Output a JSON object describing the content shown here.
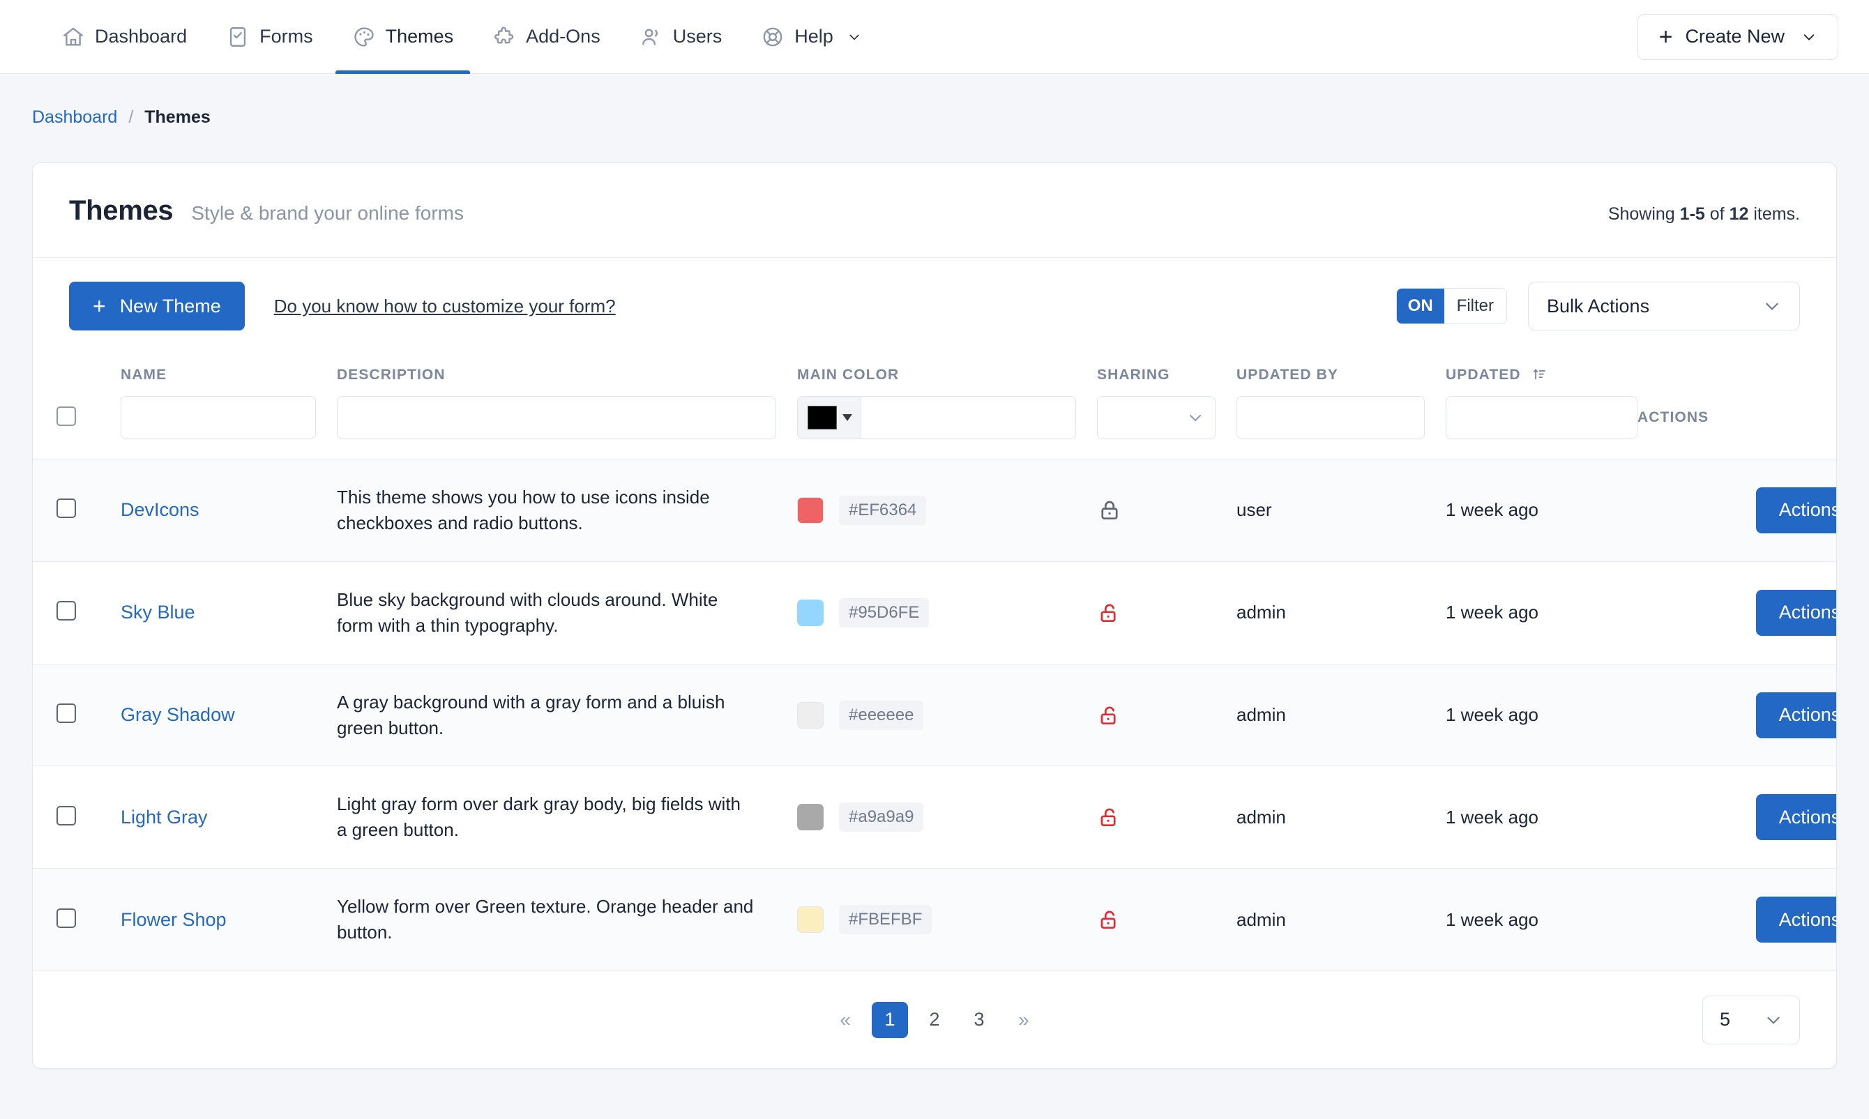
{
  "nav": {
    "items": [
      {
        "label": "Dashboard",
        "icon": "home-icon",
        "active": false
      },
      {
        "label": "Forms",
        "icon": "form-check-icon",
        "active": false
      },
      {
        "label": "Themes",
        "icon": "palette-icon",
        "active": true
      },
      {
        "label": "Add-Ons",
        "icon": "puzzle-icon",
        "active": false
      },
      {
        "label": "Users",
        "icon": "users-icon",
        "active": false
      },
      {
        "label": "Help",
        "icon": "lifebuoy-icon",
        "active": false,
        "has_caret": true
      }
    ],
    "create_new_label": "Create New"
  },
  "breadcrumb": {
    "root": "Dashboard",
    "separator": "/",
    "current": "Themes"
  },
  "card": {
    "title": "Themes",
    "subtitle": "Style & brand your online forms",
    "showing": {
      "prefix": "Showing ",
      "range": "1-5",
      "middle": " of ",
      "total": "12",
      "suffix": " items."
    }
  },
  "toolbar": {
    "new_theme_label": "New Theme",
    "hint_link": "Do you know how to customize your form?",
    "filter_toggle": {
      "state": "ON",
      "label": "Filter"
    },
    "bulk_actions_label": "Bulk Actions"
  },
  "table": {
    "headers": {
      "name": "NAME",
      "description": "DESCRIPTION",
      "main_color": "MAIN COLOR",
      "sharing": "SHARING",
      "updated_by": "UPDATED BY",
      "updated": "UPDATED",
      "actions": "ACTIONS"
    },
    "filters": {
      "name_value": "",
      "description_value": "",
      "color_swatch": "#000000",
      "color_value": "",
      "sharing_value": "",
      "updated_by_value": "",
      "updated_value": ""
    },
    "rows": [
      {
        "name": "DevIcons",
        "description": "This theme shows you how to use icons inside checkboxes and radio buttons.",
        "color_hex": "#EF6364",
        "swatch": "#EF6364",
        "sharing": "locked",
        "sharing_color": "#5c6675",
        "updated_by": "user",
        "updated": "1 week ago",
        "actions_label": "Actions"
      },
      {
        "name": "Sky Blue",
        "description": "Blue sky background with clouds around. White form with a thin typography.",
        "color_hex": "#95D6FE",
        "swatch": "#95D6FE",
        "sharing": "unlocked",
        "sharing_color": "#e02b32",
        "updated_by": "admin",
        "updated": "1 week ago",
        "actions_label": "Actions"
      },
      {
        "name": "Gray Shadow",
        "description": "A gray background with a gray form and a bluish green button.",
        "color_hex": "#eeeeee",
        "swatch": "#eeeeee",
        "sharing": "unlocked",
        "sharing_color": "#e02b32",
        "updated_by": "admin",
        "updated": "1 week ago",
        "actions_label": "Actions"
      },
      {
        "name": "Light Gray",
        "description": "Light gray form over dark gray body, big fields with a green button.",
        "color_hex": "#a9a9a9",
        "swatch": "#a9a9a9",
        "sharing": "unlocked",
        "sharing_color": "#e02b32",
        "updated_by": "admin",
        "updated": "1 week ago",
        "actions_label": "Actions"
      },
      {
        "name": "Flower Shop",
        "description": "Yellow form over Green texture. Orange header and button.",
        "color_hex": "#FBEFBF",
        "swatch": "#FBEFBF",
        "sharing": "unlocked",
        "sharing_color": "#e02b32",
        "updated_by": "admin",
        "updated": "1 week ago",
        "actions_label": "Actions"
      }
    ]
  },
  "footer": {
    "pages": [
      "1",
      "2",
      "3"
    ],
    "active_page": "1",
    "prev_glyph": "«",
    "next_glyph": "»",
    "per_page": "5"
  },
  "colors": {
    "accent": "#2268c4",
    "link": "#2268c4",
    "danger": "#e02b32",
    "page_bg": "#f4f6f9",
    "muted": "#8a94a6"
  }
}
